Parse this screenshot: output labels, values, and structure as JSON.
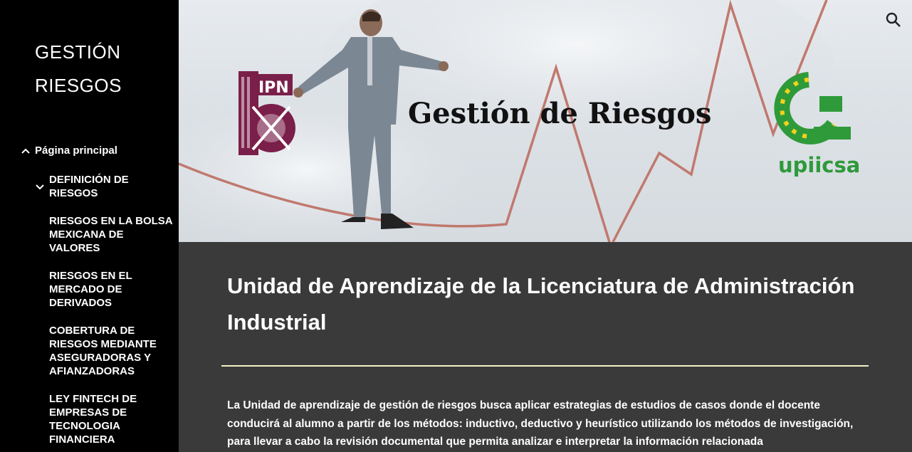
{
  "sidebar": {
    "site_title": "GESTIÓN RIESGOS",
    "home_label": "Página principal",
    "items": [
      {
        "label": "DEFINICIÓN DE RIESGOS"
      },
      {
        "label": "RIESGOS EN LA BOLSA MEXICANA DE VALORES"
      },
      {
        "label": "RIESGOS EN EL MERCADO DE DERIVADOS"
      },
      {
        "label": "COBERTURA DE RIESGOS MEDIANTE ASEGURADORAS Y AFIANZADORAS"
      },
      {
        "label": "LEY FINTECH DE EMPRESAS DE TECNOLOGIA FINANCIERA"
      }
    ]
  },
  "hero": {
    "title": "Gestión de Riesgos",
    "left_logo_text": "IPN",
    "right_logo_text": "upiicsa"
  },
  "content": {
    "heading": "Unidad de Aprendizaje de la Licenciatura de Administración Industrial",
    "body": "La Unidad de aprendizaje de gestión de riesgos busca aplicar estrategias de estudios de casos donde el docente conducirá al alumno a partir de los métodos: inductivo, deductivo y heurístico utilizando los métodos de investigación, para llevar a cabo la revisión documental que permita analizar e interpretar la información relacionada"
  },
  "colors": {
    "sidebar_bg": "#000000",
    "content_bg": "#3a3a3a",
    "divider": "#f3efc4",
    "ipn_maroon": "#7a1f4a",
    "upiicsa_green": "#2e9a3a",
    "chart_line": "#c0796e"
  },
  "icons": [
    "search-icon",
    "chevron-up-icon",
    "chevron-down-icon"
  ]
}
